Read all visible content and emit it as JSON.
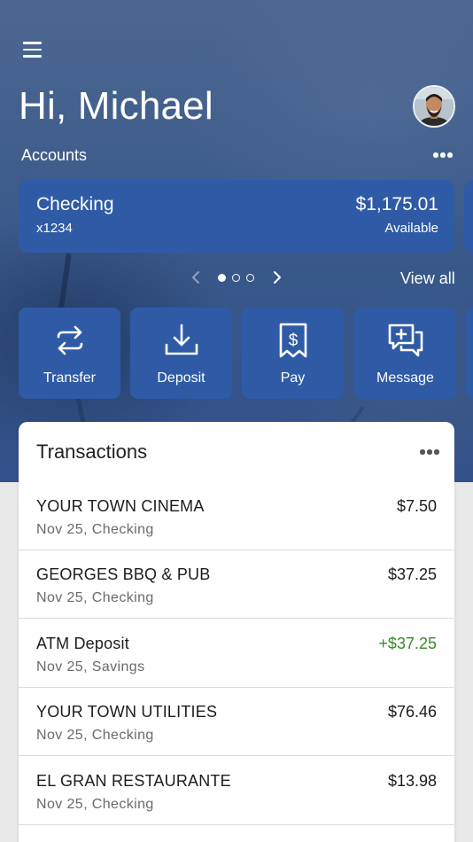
{
  "header": {
    "greeting": "Hi, Michael",
    "accounts_label": "Accounts",
    "menu_icon": "hamburger-menu-icon",
    "avatar": "user-avatar"
  },
  "accounts": {
    "cards": [
      {
        "name": "Checking",
        "number": "x1234",
        "balance": "$1,175.01",
        "balance_label": "Available"
      }
    ],
    "pager": {
      "total": 3,
      "active": 0
    },
    "view_all": "View all"
  },
  "actions": [
    {
      "label": "Transfer",
      "icon": "transfer-arrows-icon"
    },
    {
      "label": "Deposit",
      "icon": "deposit-download-icon"
    },
    {
      "label": "Pay",
      "icon": "pay-receipt-icon"
    },
    {
      "label": "Message",
      "icon": "message-plus-icon"
    }
  ],
  "transactions": {
    "title": "Transactions",
    "items": [
      {
        "name": "YOUR TOWN CINEMA",
        "meta": "Nov 25, Checking",
        "amount": "$7.50",
        "credit": false
      },
      {
        "name": "GEORGES BBQ & PUB",
        "meta": "Nov 25, Checking",
        "amount": "$37.25",
        "credit": false
      },
      {
        "name": "ATM Deposit",
        "meta": "Nov 25, Savings",
        "amount": "+$37.25",
        "credit": true
      },
      {
        "name": "YOUR TOWN UTILITIES",
        "meta": "Nov 25, Checking",
        "amount": "$76.46",
        "credit": false
      },
      {
        "name": "EL GRAN RESTAURANTE",
        "meta": "Nov 25, Checking",
        "amount": "$13.98",
        "credit": false
      }
    ]
  },
  "colors": {
    "brand_blue": "#2f5ba6",
    "credit_green": "#3a8a2a",
    "hero_bg": "#3f5d8c"
  }
}
